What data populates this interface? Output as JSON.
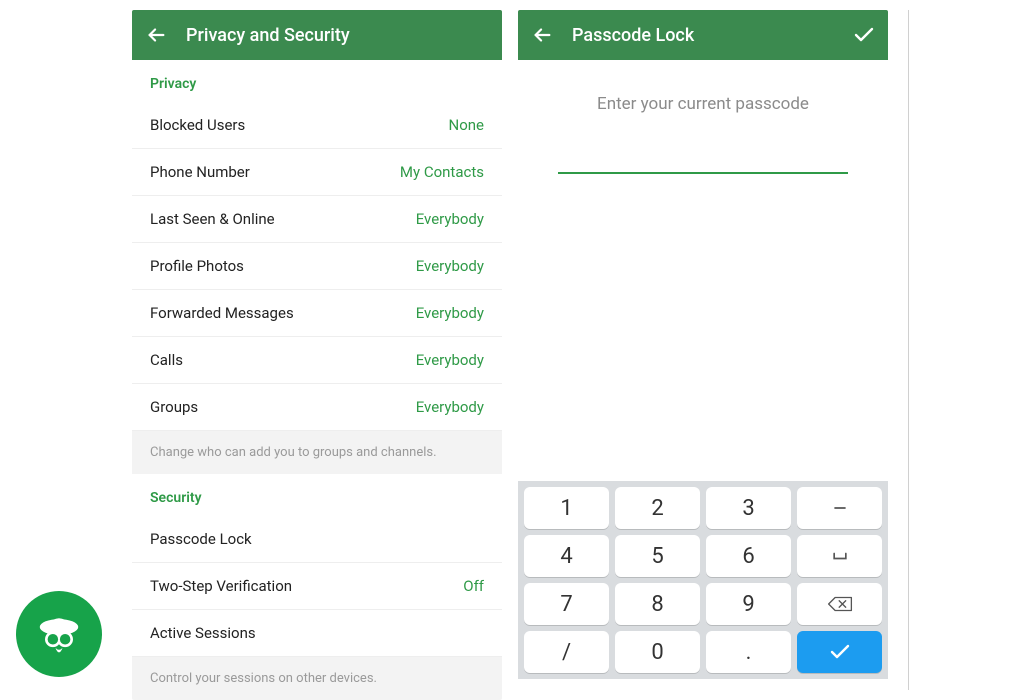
{
  "left": {
    "title": "Privacy and Security",
    "sections": [
      {
        "header": "Privacy",
        "rows": [
          {
            "label": "Blocked Users",
            "value": "None"
          },
          {
            "label": "Phone Number",
            "value": "My Contacts"
          },
          {
            "label": "Last Seen & Online",
            "value": "Everybody"
          },
          {
            "label": "Profile Photos",
            "value": "Everybody"
          },
          {
            "label": "Forwarded Messages",
            "value": "Everybody"
          },
          {
            "label": "Calls",
            "value": "Everybody"
          },
          {
            "label": "Groups",
            "value": "Everybody"
          }
        ],
        "hint": "Change who can add you to groups and channels."
      },
      {
        "header": "Security",
        "rows": [
          {
            "label": "Passcode Lock",
            "value": ""
          },
          {
            "label": "Two-Step Verification",
            "value": "Off"
          },
          {
            "label": "Active Sessions",
            "value": ""
          }
        ],
        "hint": "Control your sessions on other devices."
      }
    ]
  },
  "right": {
    "title": "Passcode Lock",
    "prompt": "Enter your current passcode",
    "keypad": [
      [
        "1",
        "2",
        "3",
        "-"
      ],
      [
        "4",
        "5",
        "6",
        "␣"
      ],
      [
        "7",
        "8",
        "9",
        "⌫"
      ],
      [
        "/",
        "0",
        ".",
        "✓"
      ]
    ]
  }
}
